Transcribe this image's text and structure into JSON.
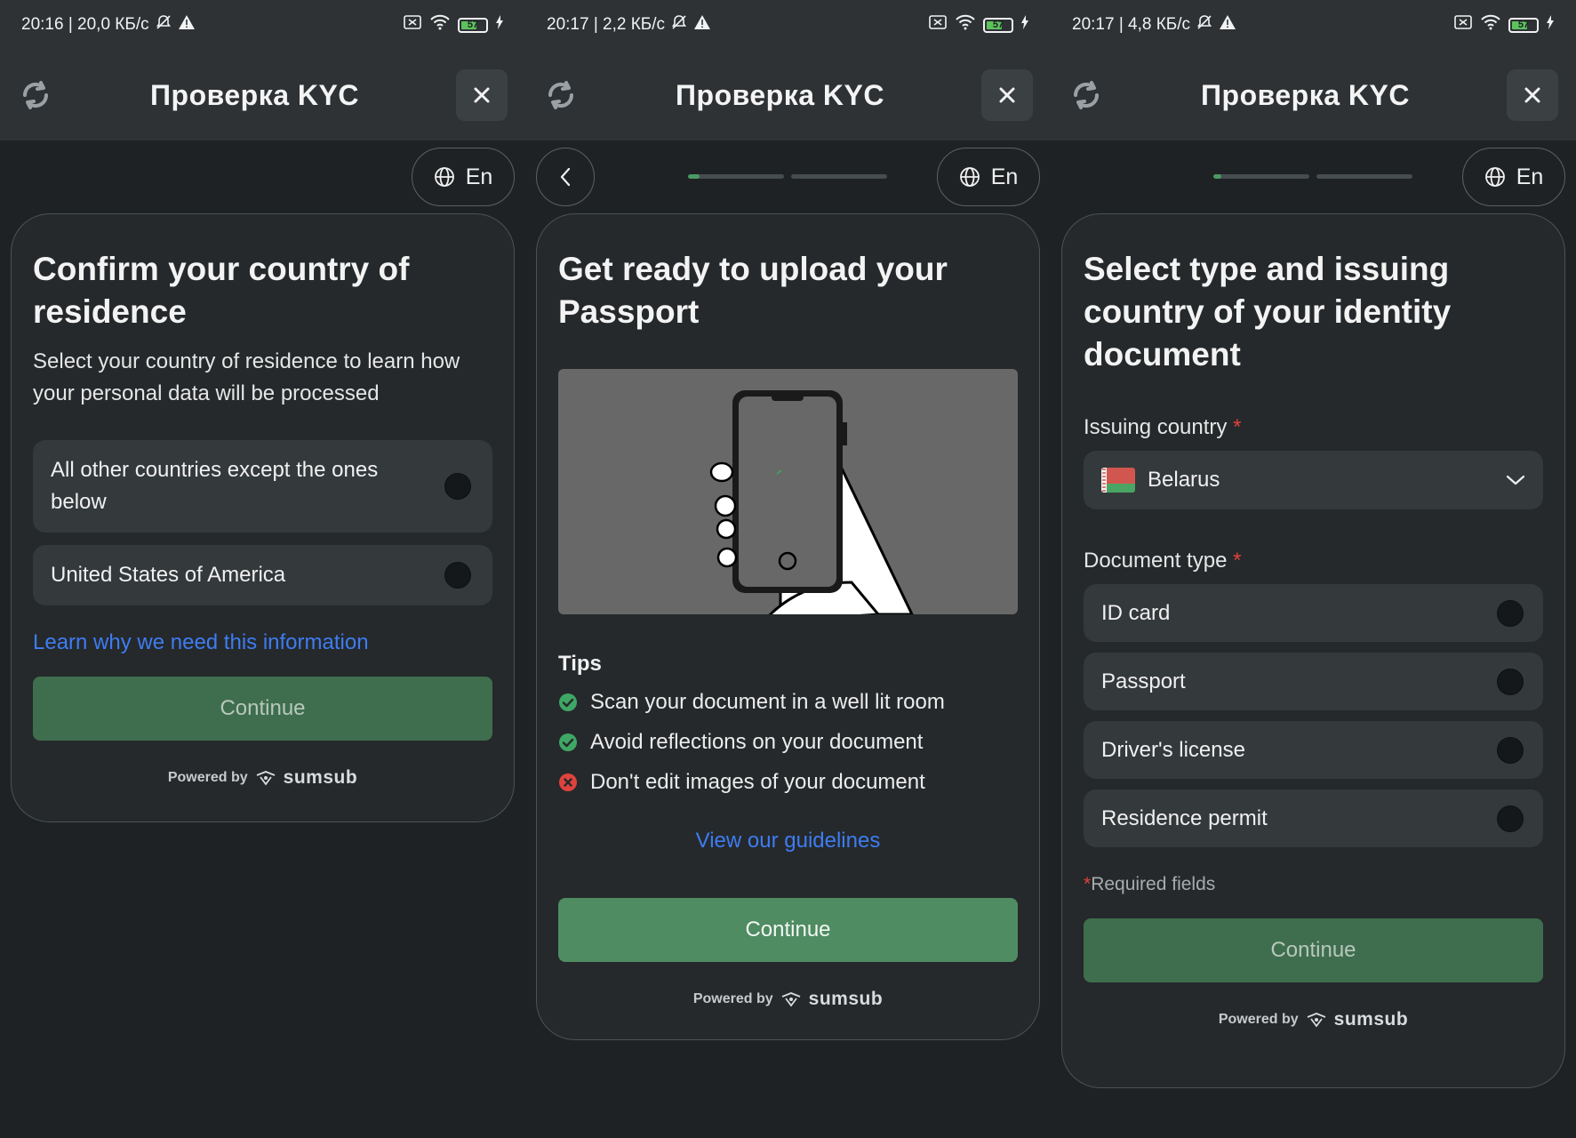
{
  "colors": {
    "background": "#1f2224",
    "card": "#25292b",
    "option": "#34393c",
    "accent_green": "#4f8c62",
    "accent_green_disabled": "#3f6e4e",
    "link_blue": "#3e7cf2",
    "required_red": "#e0433d",
    "progress_active": "#4a9a64"
  },
  "panels": [
    {
      "status": {
        "text": "20:16 | 20,0 КБ/с",
        "battery": "57"
      },
      "appbar": {
        "title": "Проверка KYC"
      },
      "lang": "En",
      "title": "Confirm your country of residence",
      "subtitle": "Select your country of residence to learn how your personal data will be processed",
      "options": [
        {
          "label": "All other countries except the ones below"
        },
        {
          "label": "United States of America"
        }
      ],
      "link": "Learn why we need this information",
      "continue": "Continue",
      "powered_by": "Powered by",
      "brand": "sumsub"
    },
    {
      "status": {
        "text": "20:17 | 2,2 КБ/с",
        "battery": "57"
      },
      "appbar": {
        "title": "Проверка KYC"
      },
      "lang": "En",
      "progress": [
        0.12,
        0.0
      ],
      "title": "Get ready to upload your Passport",
      "tips_title": "Tips",
      "tips": [
        {
          "icon": "check-circle-icon",
          "status": "ok",
          "text": "Scan your document in a well lit room"
        },
        {
          "icon": "check-circle-icon",
          "status": "ok",
          "text": "Avoid reflections on your document"
        },
        {
          "icon": "cross-circle-icon",
          "status": "bad",
          "text": "Don't edit images of your document"
        }
      ],
      "link": "View our guidelines",
      "continue": "Continue",
      "powered_by": "Powered by",
      "brand": "sumsub"
    },
    {
      "status": {
        "text": "20:17 | 4,8 КБ/с",
        "battery": "57"
      },
      "appbar": {
        "title": "Проверка KYC"
      },
      "lang": "En",
      "progress": [
        0.08,
        0.0
      ],
      "title": "Select type and issuing country of your identity document",
      "issuing_country_label": "Issuing country",
      "required_mark": "*",
      "issuing_country_value": "Belarus",
      "document_type_label": "Document type",
      "document_types": [
        {
          "label": "ID card"
        },
        {
          "label": "Passport"
        },
        {
          "label": "Driver's license"
        },
        {
          "label": "Residence permit"
        }
      ],
      "required_note": "Required fields",
      "continue": "Continue",
      "powered_by": "Powered by",
      "brand": "sumsub"
    }
  ]
}
